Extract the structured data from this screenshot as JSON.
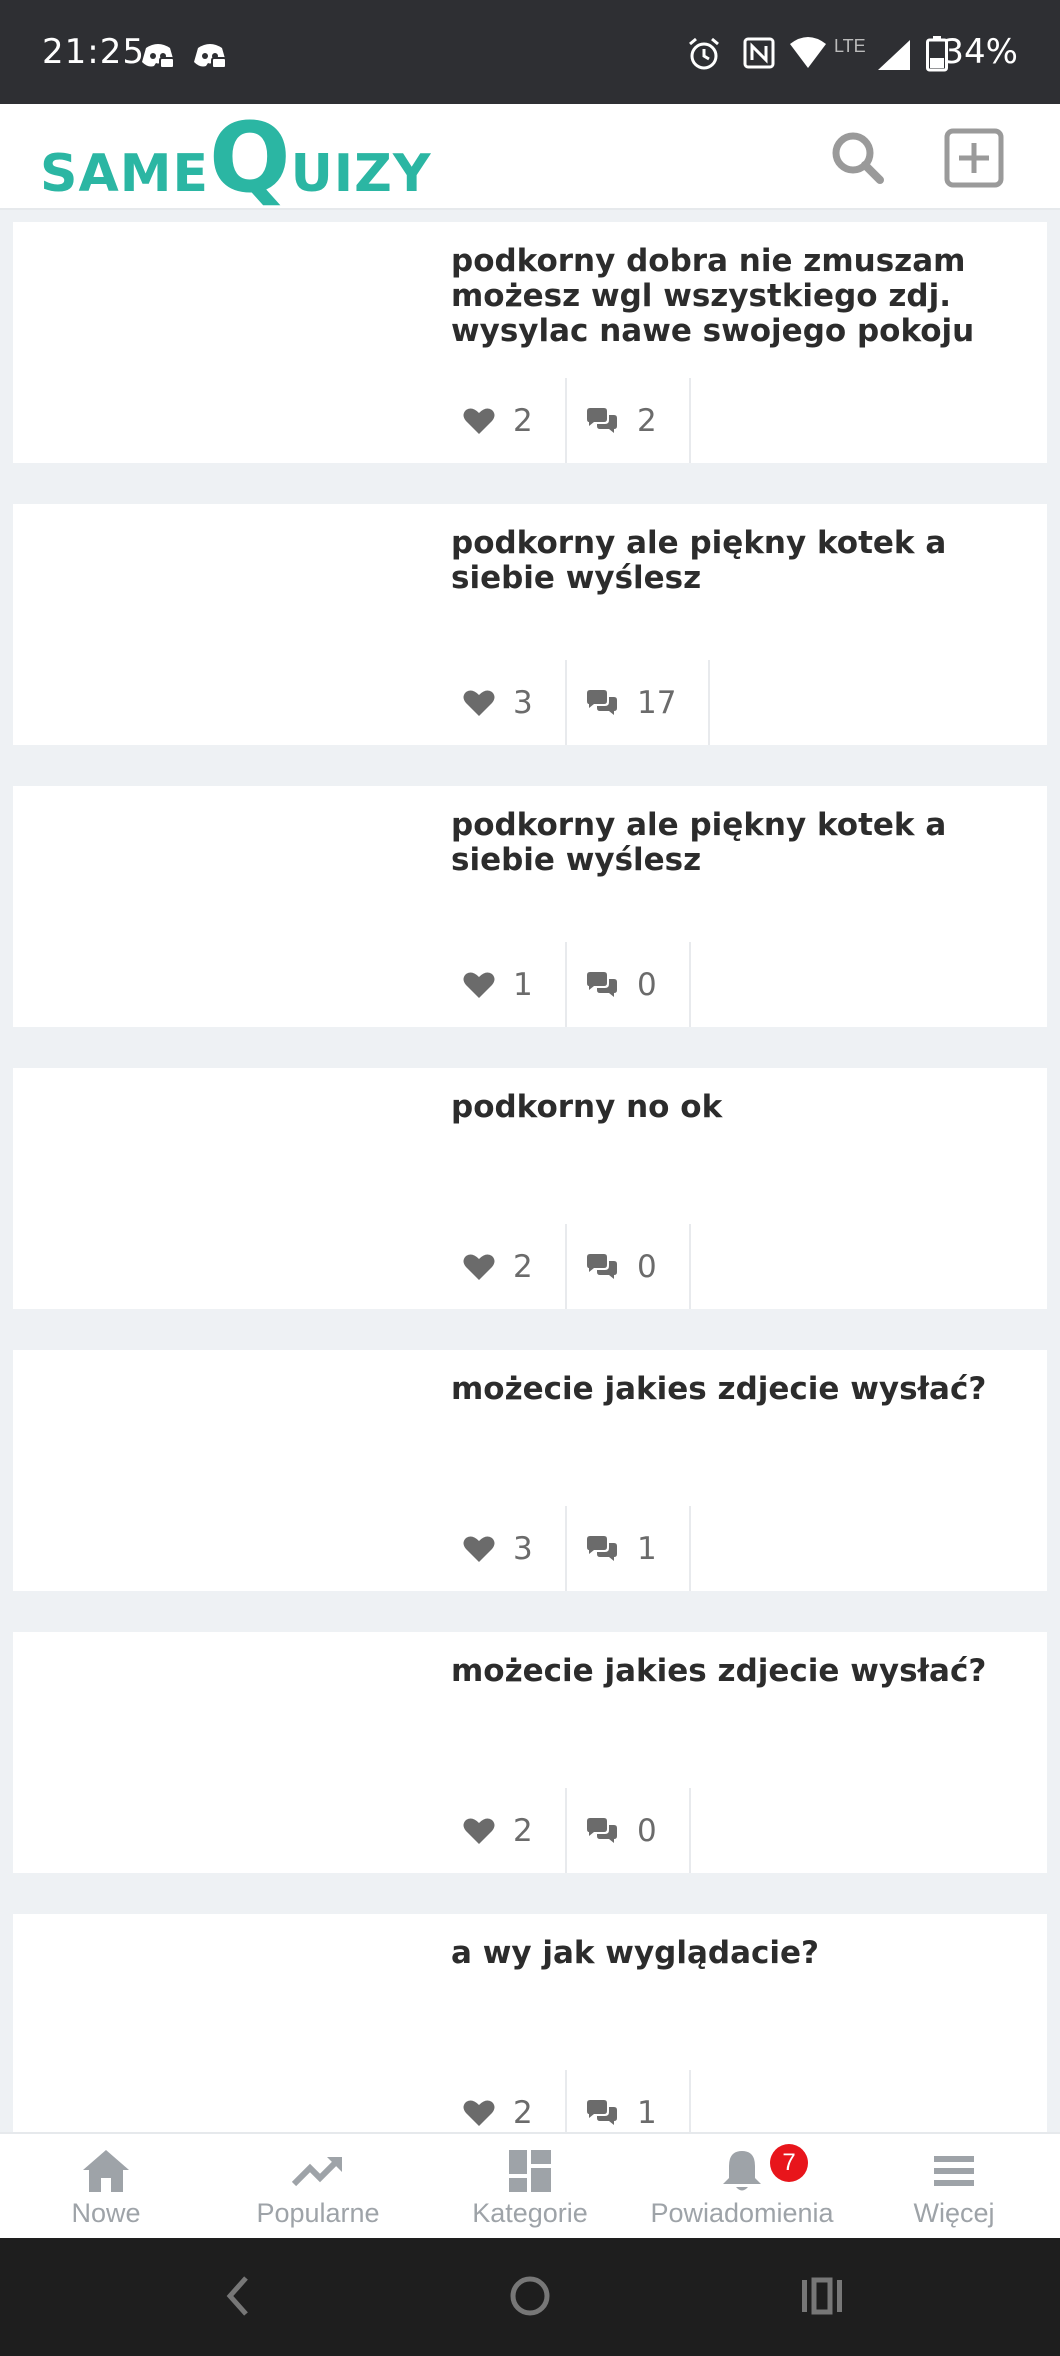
{
  "status_bar": {
    "time": "21:25",
    "battery": "34%",
    "network": "LTE",
    "icons": [
      "discord-icon",
      "discord-icon",
      "alarm-icon",
      "nfc-icon",
      "wifi-icon",
      "signal-icon",
      "battery-icon"
    ]
  },
  "header": {
    "logo_small_a": "SAME",
    "logo_big": "Q",
    "logo_small_b": "UIZY",
    "brand_color": "#2bb6a3",
    "icons": [
      "search-icon",
      "add-icon"
    ]
  },
  "posts": [
    {
      "title": "podkorny dobra nie zmuszam możesz wgl wszystkiego zdj. wysylac nawe swojego pokoju",
      "likes": "2",
      "comments": "2"
    },
    {
      "title": "podkorny ale piękny kotek a siebie wyślesz",
      "likes": "3",
      "comments": "17"
    },
    {
      "title": "podkorny ale piękny kotek a siebie wyślesz",
      "likes": "1",
      "comments": "0"
    },
    {
      "title": "podkorny no ok",
      "likes": "2",
      "comments": "0"
    },
    {
      "title": "możecie jakies zdjecie wysłać?",
      "likes": "3",
      "comments": "1"
    },
    {
      "title": "możecie jakies zdjecie wysłać?",
      "likes": "2",
      "comments": "0"
    },
    {
      "title": "a wy jak wyglądacie?",
      "likes": "2",
      "comments": "1"
    }
  ],
  "bottom_nav": {
    "items": [
      {
        "label": "Nowe",
        "icon": "home-icon"
      },
      {
        "label": "Popularne",
        "icon": "trending-icon"
      },
      {
        "label": "Kategorie",
        "icon": "categories-icon"
      },
      {
        "label": "Powiadomienia",
        "icon": "bell-icon"
      },
      {
        "label": "Więcej",
        "icon": "menu-icon"
      }
    ],
    "notification_count": "7",
    "badge_color": "#e8151b"
  },
  "system_nav": {
    "icons": [
      "back-icon",
      "home-circle-icon",
      "recents-icon"
    ]
  }
}
